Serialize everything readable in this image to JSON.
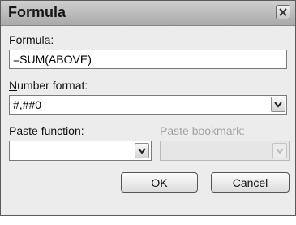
{
  "dialog": {
    "title": "Formula",
    "close_icon": "close-icon"
  },
  "formula": {
    "label_accel": "F",
    "label_rest": "ormula:",
    "value": "=SUM(ABOVE)"
  },
  "number_format": {
    "label_accel": "N",
    "label_rest": "umber format:",
    "value": "#,##0"
  },
  "paste_function": {
    "label_pre": "Paste f",
    "label_accel": "u",
    "label_post": "nction:",
    "value": ""
  },
  "paste_bookmark": {
    "label": "Paste bookmark:",
    "value": "",
    "disabled": true
  },
  "buttons": {
    "ok": "OK",
    "cancel": "Cancel"
  },
  "icons": {
    "dropdown": "chevron-down-icon",
    "close": "close-icon"
  }
}
